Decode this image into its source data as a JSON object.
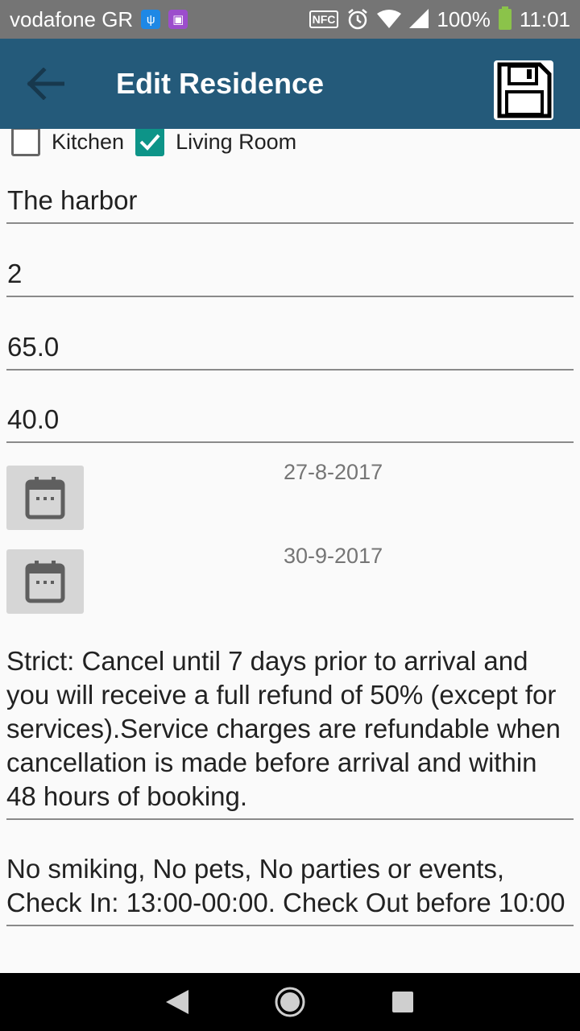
{
  "status_bar": {
    "carrier": "vodafone GR",
    "nfc": "NFC",
    "battery": "100%",
    "time": "11:01"
  },
  "app_bar": {
    "title": "Edit Residence",
    "color": "#245a7a"
  },
  "amenities": {
    "kitchen": {
      "label": "Kitchen",
      "checked": false
    },
    "living_room": {
      "label": "Living Room",
      "checked": true
    }
  },
  "fields": {
    "name": "The harbor",
    "guests": "2",
    "price": "65.0",
    "extra": "40.0"
  },
  "dates": {
    "start": "27-8-2017",
    "end": "30-9-2017"
  },
  "policy": {
    "cancellation": "Strict: Cancel until 7 days prior to arrival and you will receive a full refund of 50% (except for services).Service charges are refundable when cancellation is made before arrival and within 48 hours of booking.",
    "rules": "No smiking, No pets, No parties or events, Check In: 13:00-00:00. Check Out before 10:00"
  },
  "icons": {
    "back": "arrow-left-icon",
    "save": "floppy-disk-icon",
    "calendar": "calendar-icon"
  }
}
